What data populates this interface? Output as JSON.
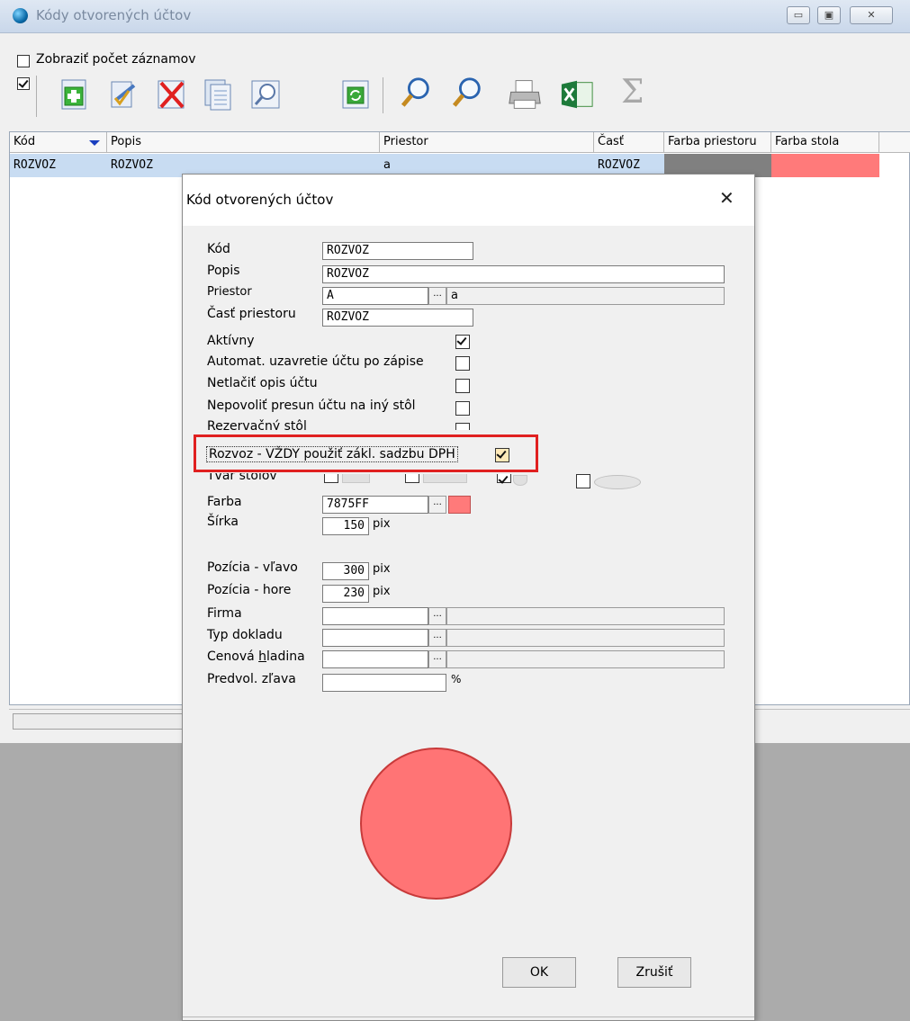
{
  "window": {
    "title": "Kódy otvorených účtov",
    "controls": {
      "minimize": "▭",
      "maximize": "▣",
      "close": "✕"
    }
  },
  "toolbar": {
    "show_count_label": "Zobraziť počet záznamov",
    "icons": [
      "add-icon",
      "edit-icon",
      "delete-icon",
      "copy-icon",
      "find-icon",
      "refresh-icon",
      "search-icon",
      "search-next-icon",
      "print-icon",
      "excel-icon",
      "sum-icon"
    ],
    "sum_glyph": "Σ"
  },
  "grid": {
    "columns": [
      "Kód",
      "Popis",
      "Priestor",
      "Časť",
      "Farba priestoru",
      "Farba stola"
    ],
    "rows": [
      {
        "kod": "ROZVOZ",
        "popis": "ROZVOZ",
        "priestor": "a",
        "cast": "ROZVOZ",
        "farba_priestoru": "#808080",
        "farba_stola": "#ff7a7a"
      }
    ]
  },
  "dialog": {
    "title": "Kód otvorených účtov",
    "close_glyph": "✕",
    "fields": {
      "kod": {
        "label": "Kód",
        "value": "ROZVOZ"
      },
      "popis": {
        "label": "Popis",
        "value": "ROZVOZ"
      },
      "priestor": {
        "label": "Priestor",
        "value": "A",
        "desc": "a"
      },
      "cast": {
        "label": "Časť priestoru",
        "value": "ROZVOZ"
      },
      "farba": {
        "label": "Farba",
        "value": "7875FF",
        "swatch": "#ff7a7a"
      },
      "sirka": {
        "label": "Šírka",
        "value": "150",
        "unit": "pix"
      },
      "poz_vlavo": {
        "label": "Pozícia - vľavo",
        "value": "300",
        "unit": "pix"
      },
      "poz_hore": {
        "label": "Pozícia - hore",
        "value": "230",
        "unit": "pix"
      },
      "firma": {
        "label": "Firma",
        "value": ""
      },
      "typ_dokladu": {
        "label": "Typ dokladu",
        "value": ""
      },
      "cenova_hladina": {
        "label_pre": "Cenová ",
        "label_u": "h",
        "label_post": "ladina",
        "value": ""
      },
      "predvol_zlava": {
        "label": "Predvol. zľava",
        "value": "",
        "unit": "%"
      }
    },
    "checkboxes": [
      {
        "label": "Aktívny",
        "checked": true
      },
      {
        "label": "Automat. uzavretie účtu po zápise",
        "checked": false
      },
      {
        "label": "Netlačiť opis účtu",
        "checked": false
      },
      {
        "label": "Nepovoliť presun účtu na iný stôl",
        "checked": false
      },
      {
        "label": "Rezervačný stôl",
        "checked": false
      },
      {
        "label": "Rozvoz - VŽDY použiť zákl. sadzbu DPH",
        "checked": true
      }
    ],
    "shape_label": "Tvar stolov",
    "shape_options": [
      {
        "name": "square",
        "checked": false
      },
      {
        "name": "rectangle",
        "checked": false
      },
      {
        "name": "circle",
        "checked": true
      },
      {
        "name": "ellipse",
        "checked": false
      }
    ],
    "dots_glyph": "...",
    "preview_color": "#ff7475",
    "ok_label": "OK",
    "cancel_label": "Zrušiť",
    "highlight_color": "#e02020"
  }
}
